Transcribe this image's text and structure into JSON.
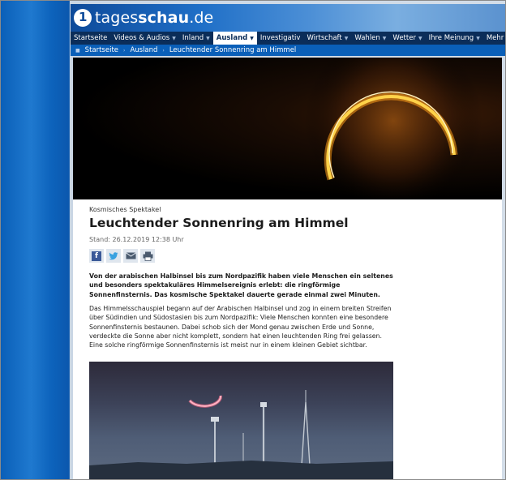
{
  "site": {
    "logo_prefix": "tages",
    "logo_bold": "schau",
    "logo_suffix": ".de"
  },
  "nav": {
    "items": [
      {
        "label": "Startseite",
        "has_menu": false
      },
      {
        "label": "Videos & Audios",
        "has_menu": true
      },
      {
        "label": "Inland",
        "has_menu": true
      },
      {
        "label": "Ausland",
        "has_menu": true,
        "active": true
      },
      {
        "label": "Investigativ",
        "has_menu": false
      },
      {
        "label": "Wirtschaft",
        "has_menu": true
      },
      {
        "label": "Wahlen",
        "has_menu": true
      },
      {
        "label": "Wetter",
        "has_menu": true
      },
      {
        "label": "Ihre Meinung",
        "has_menu": true
      },
      {
        "label": "Mehr",
        "has_menu": true
      }
    ],
    "menu_arrow": "▼"
  },
  "breadcrumb": {
    "items": [
      "Startseite",
      "Ausland",
      "Leuchtender Sonnenring am Himmel"
    ],
    "bullet": "■",
    "separator": "›"
  },
  "article": {
    "kicker": "Kosmisches Spektakel",
    "title": "Leuchtender Sonnenring am Himmel",
    "date": "Stand: 26.12.2019 12:38 Uhr",
    "lead": "Von der arabischen Halbinsel bis zum Nordpazifik haben viele Menschen ein seltenes und besonders spektakuläres Himmelsereignis erlebt: die ringförmige Sonnenfinsternis. Das kosmische Spektakel dauerte gerade einmal zwei Minuten.",
    "body": "Das Himmelsschauspiel begann auf der Arabischen Halbinsel und zog in einem breiten Streifen über Südindien und Südostasien bis zum Nordpazifik: Viele Menschen konnten eine besondere Sonnenfinsternis bestaunen. Dabei schob sich der Mond genau zwischen Erde und Sonne, verdeckte die Sonne aber nicht komplett, sondern hat einen leuchtenden Ring frei gelassen. Eine solche ringförmige Sonnenfinsternis ist meist nur in einem kleinen Gebiet sichtbar."
  },
  "share": {
    "icons": [
      "facebook-icon",
      "twitter-icon",
      "mail-icon",
      "print-icon"
    ],
    "facebook_glyph": "f"
  },
  "colors": {
    "brand_blue": "#0a5fb8",
    "nav_dark": "#0b2d59",
    "eclipse_ring": "#ffd34a"
  }
}
